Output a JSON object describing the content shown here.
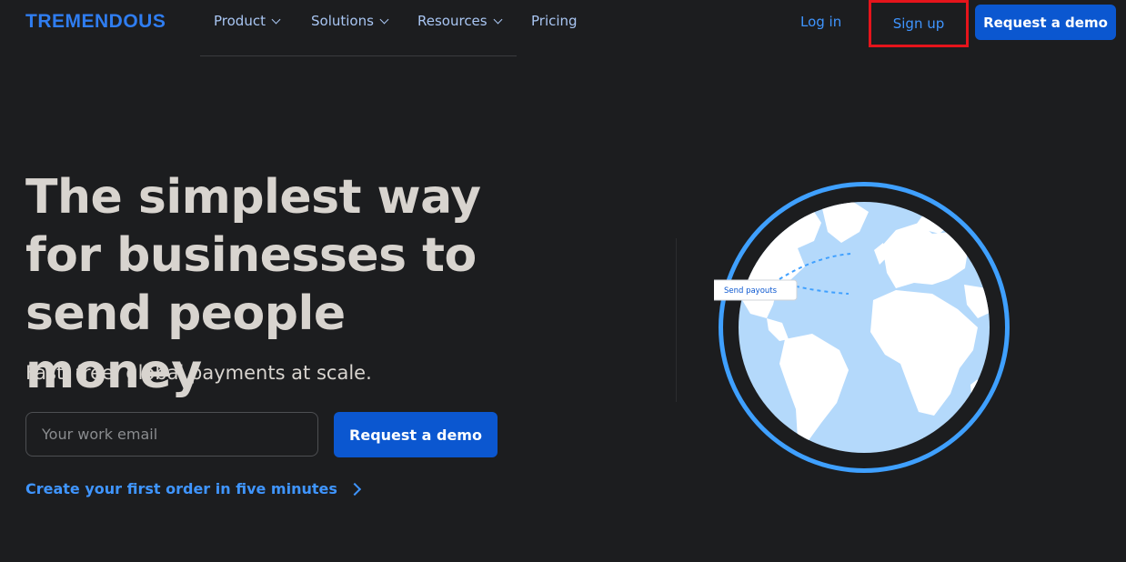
{
  "header": {
    "logo": "TREMENDOUS",
    "nav": [
      {
        "label": "Product",
        "dropdown": true
      },
      {
        "label": "Solutions",
        "dropdown": true
      },
      {
        "label": "Resources",
        "dropdown": true
      },
      {
        "label": "Pricing",
        "dropdown": false
      }
    ],
    "login": "Log in",
    "signup": "Sign up",
    "request_demo": "Request a demo"
  },
  "hero": {
    "headline_1": "The simplest way",
    "headline_2": "for businesses to",
    "headline_3": "send people money",
    "subheading": "Fast, free, global payments at scale.",
    "email_placeholder": "Your work email",
    "cta": "Request a demo",
    "create_link": "Create your first order in five minutes"
  },
  "illustration": {
    "tooltip": "Send payouts",
    "colors": {
      "ring": "#3fa0ff",
      "ocean": "#b4d9fb",
      "land": "#ffffff",
      "accent": "#0b57d0"
    }
  }
}
